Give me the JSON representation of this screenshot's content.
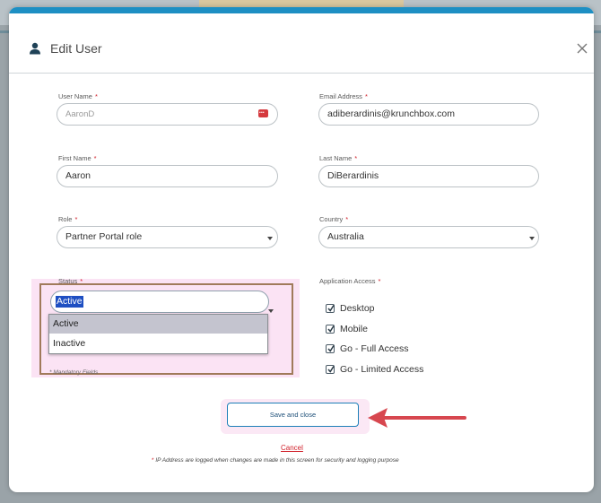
{
  "modal": {
    "title": "Edit User",
    "title_icon": "user-icon",
    "close_icon": "close-icon"
  },
  "fields": {
    "user_name": {
      "label": "User Name",
      "value": "AaronD",
      "required_mark": "*"
    },
    "email": {
      "label": "Email Address",
      "value": "adiberardinis@krunchbox.com",
      "required_mark": "*"
    },
    "first_name": {
      "label": "First Name",
      "value": "Aaron",
      "required_mark": "*"
    },
    "last_name": {
      "label": "Last Name",
      "value": "DiBerardinis",
      "required_mark": "*"
    },
    "role": {
      "label": "Role",
      "value": "Partner Portal role",
      "required_mark": "*"
    },
    "country": {
      "label": "Country",
      "value": "Australia",
      "required_mark": "*"
    },
    "status": {
      "label": "Status",
      "required_mark": "*",
      "value": "Active",
      "options": [
        {
          "label": "Active",
          "selected": true
        },
        {
          "label": "Inactive",
          "selected": false
        }
      ]
    }
  },
  "application_access": {
    "label": "Application Access",
    "required_mark": "*",
    "items": [
      {
        "label": "Desktop",
        "checked": true
      },
      {
        "label": "Mobile",
        "checked": true
      },
      {
        "label": "Go - Full Access",
        "checked": true
      },
      {
        "label": "Go - Limited Access",
        "checked": true
      }
    ]
  },
  "notes": {
    "mandatory": "* Mandatory Fields",
    "ip_star": "*",
    "ip_text": " IP Address are logged when changes are made in this screen for security and logging purpose"
  },
  "actions": {
    "save_label": "Save and close",
    "cancel_label": "Cancel"
  },
  "colors": {
    "accent": "#1d8fc3",
    "required": "#d0202a",
    "highlight_box": "#a07a5a",
    "annotation_arrow": "#d7474f",
    "selection": "#1e4fc2"
  }
}
